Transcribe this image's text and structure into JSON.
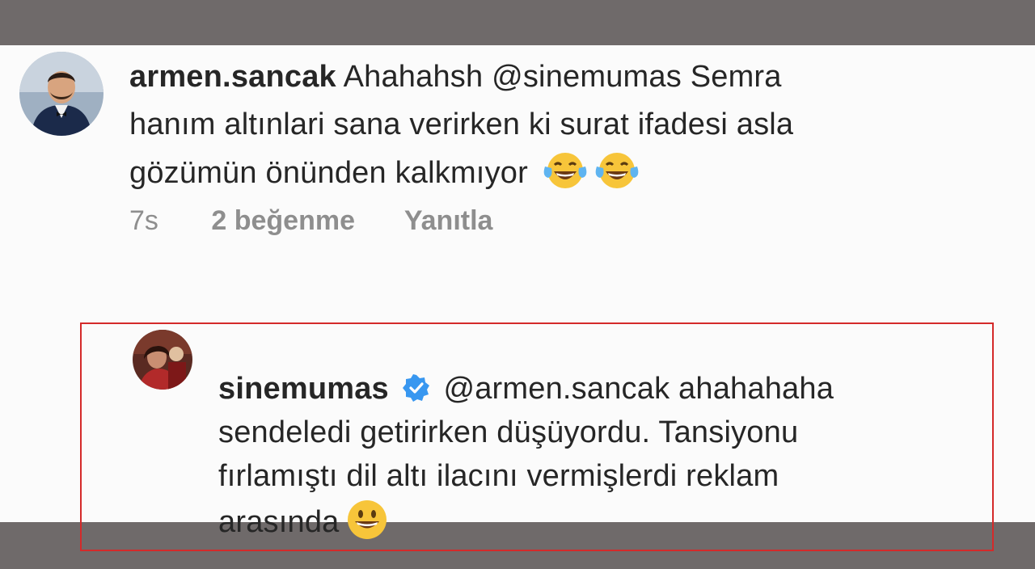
{
  "comment1": {
    "username": "armen.sancak",
    "text_line1": "Ahahahsh @sinemumas Semra",
    "text_line2": "hanım altınlari sana verirken ki surat ifadesi asla",
    "text_line3": "gözümün önünden kalkmıyor",
    "emojis": [
      "tears-of-joy-emoji",
      "tears-of-joy-emoji"
    ],
    "time": "7s",
    "likes": "2 beğenme",
    "reply": "Yanıtla"
  },
  "comment2": {
    "username": "sinemumas",
    "verified": true,
    "text_line1": "@armen.sancak ahahahaha",
    "text_line2": "sendeledi getirirken düşüyordu. Tansiyonu",
    "text_line3": "fırlamıştı dil altı ilacını vermişlerdi reklam",
    "text_line4": "arasında",
    "emoji": "grinning-emoji"
  },
  "colors": {
    "frame": "#6f6a6a",
    "panel": "#fbfbfb",
    "text": "#262626",
    "meta": "#8e8e8e",
    "highlight_border": "#d42a2a",
    "verified": "#3897f0"
  }
}
